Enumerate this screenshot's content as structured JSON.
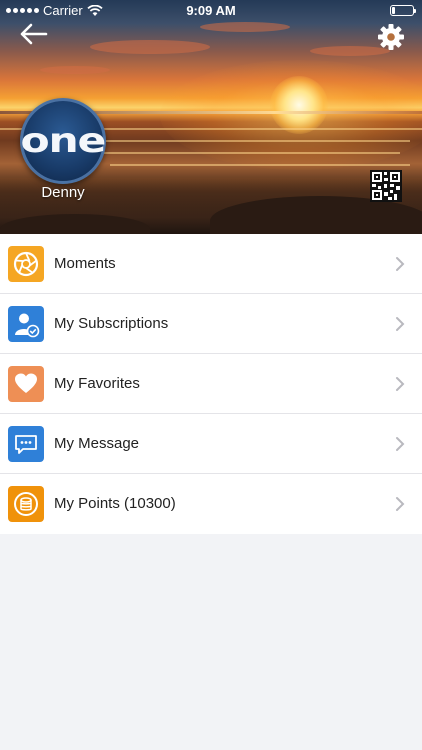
{
  "status_bar": {
    "carrier": "Carrier",
    "time": "9:09 AM",
    "battery_level": 0.15
  },
  "header": {
    "back_icon": "back-arrow-icon",
    "settings_icon": "gear-icon",
    "avatar_text": "one",
    "username": "Denny",
    "qr_icon": "qr-code-icon"
  },
  "menu": {
    "items": [
      {
        "label": "Moments",
        "icon": "aperture-icon",
        "color": "#f5a623"
      },
      {
        "label": "My Subscriptions",
        "icon": "user-check-icon",
        "color": "#2f80d8"
      },
      {
        "label": "My Favorites",
        "icon": "heart-icon",
        "color": "#ee8f55"
      },
      {
        "label": "My Message",
        "icon": "chat-bubble-icon",
        "color": "#2f80d8"
      },
      {
        "label": "My Points (10300)",
        "icon": "coins-icon",
        "color": "#f0920a"
      }
    ]
  }
}
